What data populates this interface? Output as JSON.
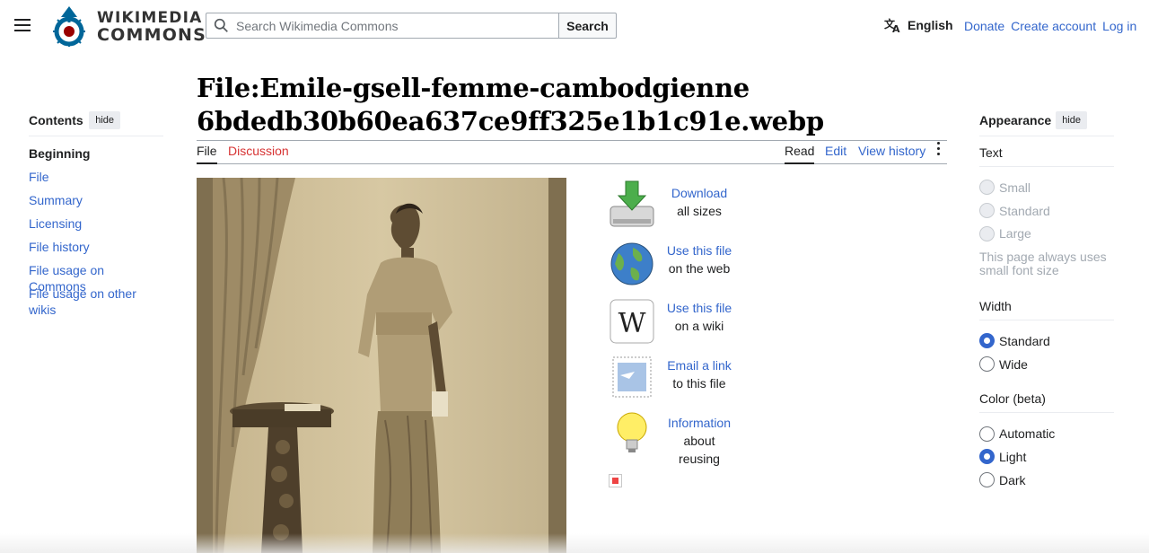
{
  "header": {
    "logo_text_line1": "WIKIMEDIA",
    "logo_text_line2": "COMMONS",
    "search_placeholder": "Search Wikimedia Commons",
    "search_button": "Search",
    "language": "English",
    "links": [
      "Donate",
      "Create account",
      "Log in"
    ]
  },
  "toc": {
    "title": "Contents",
    "hide": "hide",
    "items": [
      "Beginning",
      "File",
      "Summary",
      "Licensing",
      "File history",
      "File usage on Commons",
      "File usage on other wikis"
    ]
  },
  "page": {
    "title_line1": "File:Emile-gsell-femme-cambodgienne",
    "title_line2": "6bdedb30b60ea637ce9ff325e1b1c91e.webp",
    "tabs_left": [
      "File",
      "Discussion"
    ],
    "tabs_right": [
      "Read",
      "Edit",
      "View history"
    ]
  },
  "actions": [
    {
      "icon": "download-icon",
      "link": "Download",
      "sub": "all sizes"
    },
    {
      "icon": "globe-icon",
      "link": "Use this file",
      "sub": "on the web"
    },
    {
      "icon": "wikipedia-icon",
      "link": "Use this file",
      "sub": "on a wiki"
    },
    {
      "icon": "email-icon",
      "link": "Email a link",
      "sub": "to this file"
    },
    {
      "icon": "lightbulb-icon",
      "link": "Information",
      "sub": "about reusing"
    }
  ],
  "appearance": {
    "title": "Appearance",
    "hide": "hide",
    "text_label": "Text",
    "text_options": [
      "Small",
      "Standard",
      "Large"
    ],
    "text_note": "This page always uses small font size",
    "width_label": "Width",
    "width_options": [
      "Standard",
      "Wide"
    ],
    "width_selected": "Standard",
    "color_label": "Color (beta)",
    "color_options": [
      "Automatic",
      "Light",
      "Dark"
    ],
    "color_selected": "Light"
  },
  "colors": {
    "link": "#3366cc",
    "discussion": "#d73333",
    "accent": "#3366cc"
  }
}
